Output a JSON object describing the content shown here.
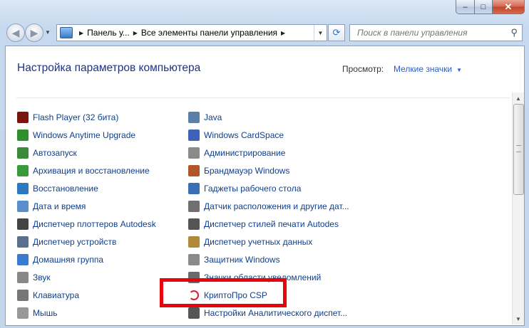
{
  "window": {
    "controls": {
      "minimize": "–",
      "maximize": "□",
      "close": "✕"
    }
  },
  "nav": {
    "back_icon": "back-arrow-icon",
    "forward_icon": "forward-arrow-icon",
    "breadcrumb": [
      "Панель у...",
      "Все элементы панели управления"
    ],
    "search_placeholder": "Поиск в панели управления"
  },
  "header": {
    "title": "Настройка параметров компьютера",
    "view_label": "Просмотр:",
    "view_value": "Мелкие значки"
  },
  "items_left": [
    {
      "label": "Flash Player (32 бита)",
      "icon": "flash-icon",
      "color": "#7a1410"
    },
    {
      "label": "Windows Anytime Upgrade",
      "icon": "windows-flag-icon",
      "color": "#2f8f2f"
    },
    {
      "label": "Автозапуск",
      "icon": "autoplay-icon",
      "color": "#3a8a3a"
    },
    {
      "label": "Архивация и восстановление",
      "icon": "backup-icon",
      "color": "#3a9a3a"
    },
    {
      "label": "Восстановление",
      "icon": "recovery-icon",
      "color": "#2a7ac0"
    },
    {
      "label": "Дата и время",
      "icon": "clock-icon",
      "color": "#5b8fc9"
    },
    {
      "label": "Диспетчер плоттеров Autodesk",
      "icon": "plotter-icon",
      "color": "#444444"
    },
    {
      "label": "Диспетчер устройств",
      "icon": "device-manager-icon",
      "color": "#5a6f8c"
    },
    {
      "label": "Домашняя группа",
      "icon": "homegroup-icon",
      "color": "#3a7ad0"
    },
    {
      "label": "Звук",
      "icon": "speaker-icon",
      "color": "#888888"
    },
    {
      "label": "Клавиатура",
      "icon": "keyboard-icon",
      "color": "#777777"
    },
    {
      "label": "Мышь",
      "icon": "mouse-icon",
      "color": "#999999"
    }
  ],
  "items_right": [
    {
      "label": "Java",
      "icon": "java-icon",
      "color": "#5b7fa8"
    },
    {
      "label": "Windows CardSpace",
      "icon": "cardspace-icon",
      "color": "#3d63b8"
    },
    {
      "label": "Администрирование",
      "icon": "admin-tools-icon",
      "color": "#8a8a8a"
    },
    {
      "label": "Брандмауэр Windows",
      "icon": "firewall-icon",
      "color": "#b0572a"
    },
    {
      "label": "Гаджеты рабочего стола",
      "icon": "gadgets-icon",
      "color": "#3a6fb8"
    },
    {
      "label": "Датчик расположения и другие дат...",
      "icon": "sensor-icon",
      "color": "#6f6f6f"
    },
    {
      "label": "Диспетчер стилей печати Autodes",
      "icon": "print-styles-icon",
      "color": "#555555"
    },
    {
      "label": "Диспетчер учетных данных",
      "icon": "credentials-icon",
      "color": "#b08a3a"
    },
    {
      "label": "Защитник Windows",
      "icon": "defender-icon",
      "color": "#8a8a8a"
    },
    {
      "label": "Значки области уведомлений",
      "icon": "notification-icon",
      "color": "#6a6a6a"
    },
    {
      "label": "КриптоПро CSP",
      "icon": "cryptopro-icon",
      "color": "#d9202b"
    },
    {
      "label": "Настройки Аналитического диспет...",
      "icon": "analytics-icon",
      "color": "#555555"
    }
  ]
}
